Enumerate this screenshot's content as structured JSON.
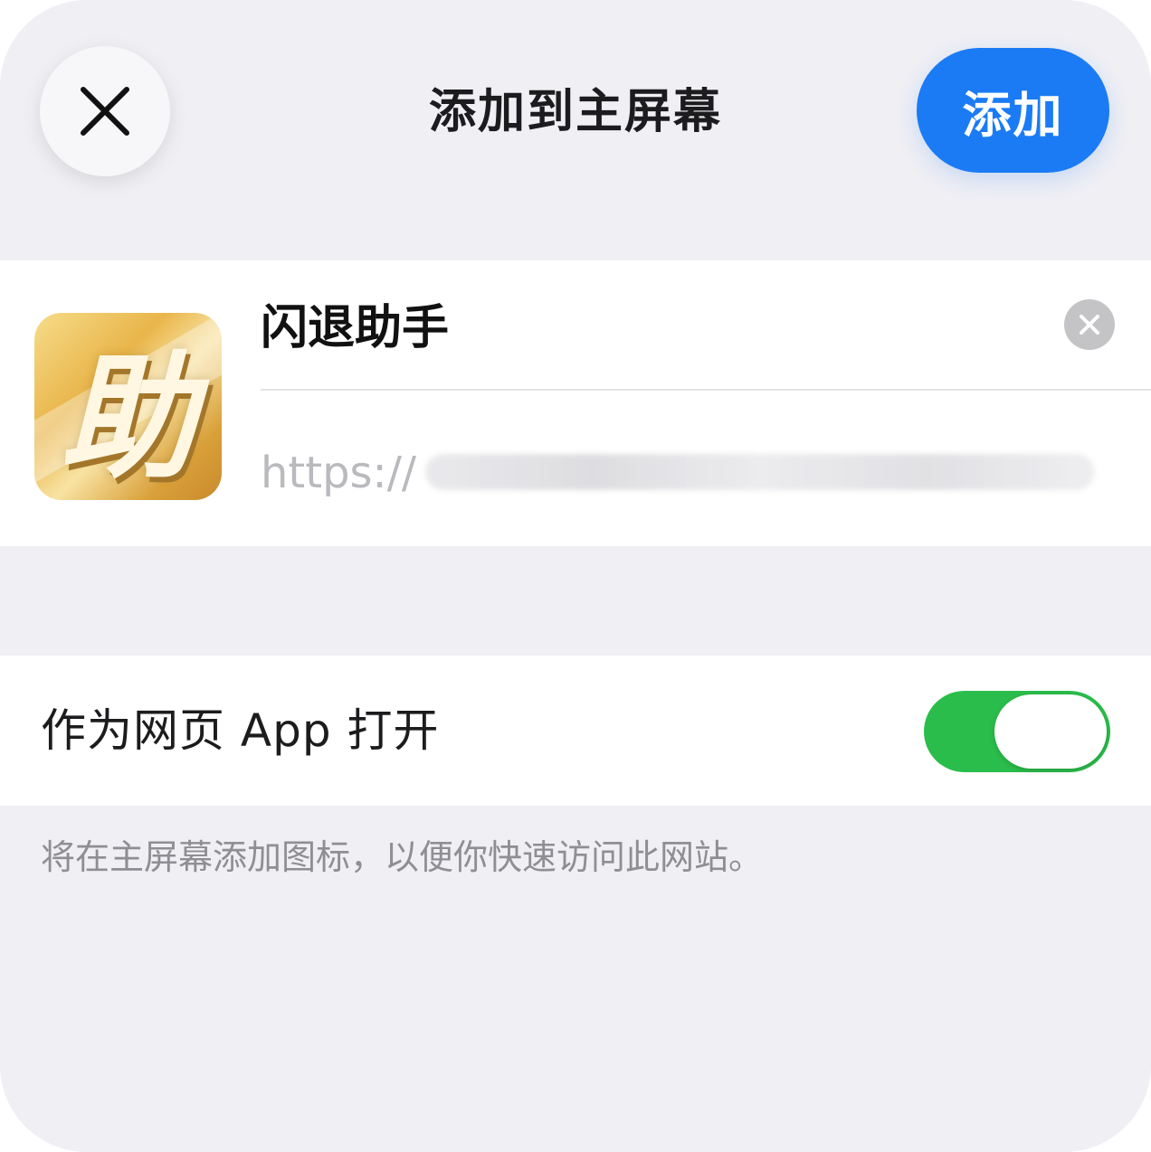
{
  "header": {
    "title": "添加到主屏幕",
    "add_label": "添加",
    "close_icon": "close-icon"
  },
  "app": {
    "icon_glyph": "助",
    "name": "闪退助手",
    "url_prefix": "https://",
    "clear_icon": "clear-icon"
  },
  "settings": {
    "open_as_web_app_label": "作为网页 App 打开",
    "open_as_web_app_on": true
  },
  "footer": {
    "note": "将在主屏幕添加图标，以便你快速访问此网站。"
  },
  "colors": {
    "accent": "#1b7bf4",
    "toggle_on": "#2bbd4b",
    "background": "#efeff4"
  }
}
